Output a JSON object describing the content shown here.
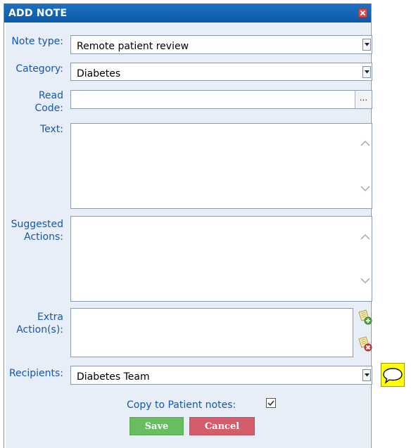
{
  "dialog": {
    "title": "ADD NOTE",
    "close_icon": "close-x-icon"
  },
  "form": {
    "note_type": {
      "label": "Note type:",
      "value": "Remote patient review"
    },
    "category": {
      "label": "Category:",
      "value": "Diabetes"
    },
    "read_code": {
      "label_line1": "Read",
      "label_line2": "Code:",
      "value": "",
      "browse_label": "..."
    },
    "text": {
      "label": "Text:",
      "value": ""
    },
    "suggested_actions": {
      "label_line1": "Suggested",
      "label_line2": "Actions:",
      "value": ""
    },
    "extra_actions": {
      "label_line1": "Extra",
      "label_line2": "Action(s):",
      "value": "",
      "add_icon": "add-document-icon",
      "remove_icon": "remove-document-icon"
    },
    "recipients": {
      "label": "Recipients:",
      "value": "Diabetes Team"
    },
    "copy_to_patient_notes": {
      "label": "Copy to Patient notes:",
      "checked": true
    }
  },
  "buttons": {
    "save_label": "Save",
    "cancel_label": "Cancel"
  },
  "side": {
    "comment_icon": "speech-bubble-icon"
  },
  "colors": {
    "title_bar": "#0b5aa8",
    "label_text": "#1656b1",
    "form_background": "#e7eef8",
    "save": "#67bd60",
    "cancel": "#d45d6b",
    "comment_background": "#ffff00"
  }
}
